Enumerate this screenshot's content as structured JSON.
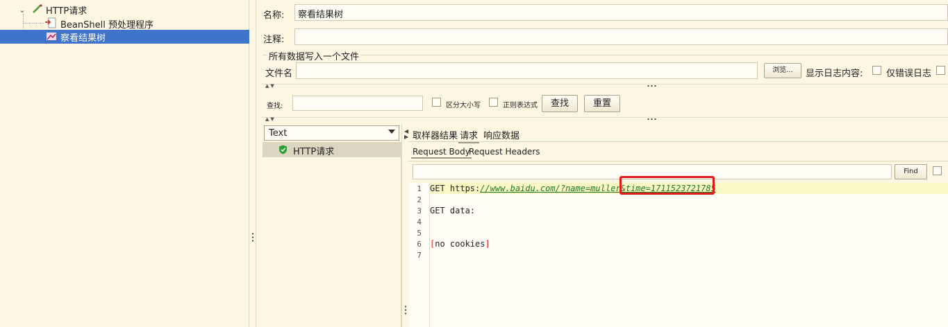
{
  "tree": {
    "http_request": "HTTP请求",
    "beanshell": "BeanShell 预处理程序",
    "result_tree": "察看结果树"
  },
  "config": {
    "name_label": "名称:",
    "name_value": "察看结果树",
    "comment_label": "注释:",
    "comment_value": "",
    "section_title": "所有数据写入一个文件",
    "file_label": "文件名",
    "file_value": "",
    "browse_btn": "浏览...",
    "log_label": "显示日志内容:",
    "errors_only": "仅错误日志"
  },
  "search": {
    "label": "查找:",
    "value": "",
    "case_label": "区分大小写",
    "regex_label": "正则表达式",
    "find_btn": "查找",
    "reset_btn": "重置"
  },
  "results": {
    "renderer": "Text",
    "item": "HTTP请求",
    "tabs": [
      "取样器结果",
      "请求",
      "响应数据"
    ],
    "subtabs": [
      "Request Body",
      "Request Headers"
    ],
    "find_btn": "Find"
  },
  "code": {
    "line_numbers": [
      "1",
      "2",
      "3",
      "4",
      "5",
      "6",
      "7"
    ],
    "line1_prefix": "GET https:",
    "line1_link": "//www.baidu.com/?name=muller&time=1711523721785",
    "line3": "GET data:",
    "line6_open": "[",
    "line6_text": "no cookies",
    "line6_close": "]"
  },
  "colors": {
    "background": "#fdf6e3",
    "selection": "#3e74c9",
    "highlight_box": "#e01b1b",
    "link": "#1d7b1d"
  }
}
